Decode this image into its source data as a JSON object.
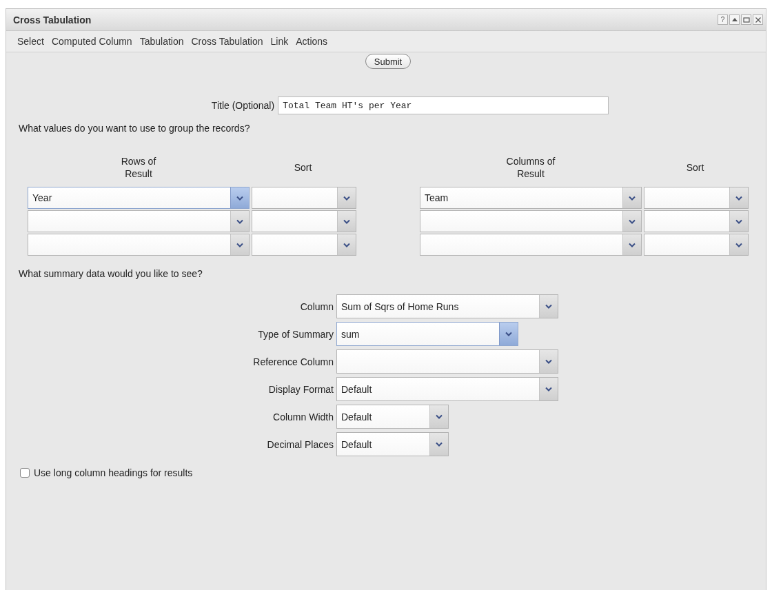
{
  "window": {
    "title": "Cross Tabulation",
    "title_buttons": [
      {
        "kind": "help",
        "glyph": "?"
      },
      {
        "kind": "collapse"
      },
      {
        "kind": "maximize"
      },
      {
        "kind": "close"
      }
    ]
  },
  "menu": [
    "Select",
    "Computed Column",
    "Tabulation",
    "Cross Tabulation",
    "Link",
    "Actions"
  ],
  "submit_button": "Submit",
  "title_field": {
    "label": "Title (Optional)",
    "value": "Total Team HT's per Year"
  },
  "group_question": "What values do you want to use to group the records?",
  "groups": [
    {
      "header": "Rows of Result",
      "sort_header": "Sort",
      "rows": [
        {
          "field": {
            "value": "Year",
            "focused": true
          },
          "sort": {
            "focused": false
          }
        },
        {
          "field": {
            "focused": false
          },
          "sort": {
            "focused": false
          }
        },
        {
          "field": {
            "focused": false
          },
          "sort": {
            "focused": false
          }
        }
      ]
    },
    {
      "header": "Columns of Result",
      "sort_header": "Sort",
      "rows": [
        {
          "field": {
            "value": "Team",
            "focused": false
          },
          "sort": {
            "focused": false
          }
        },
        {
          "field": {
            "focused": false
          },
          "sort": {
            "focused": false
          }
        },
        {
          "field": {
            "focused": false
          },
          "sort": {
            "focused": false
          }
        }
      ]
    }
  ],
  "summary_question": "What summary data would you like to see?",
  "summary_fields": [
    {
      "label": "Column",
      "value": "Sum of Sqrs of Home Runs",
      "focused": false
    },
    {
      "label": "Type of Summary",
      "value": "sum",
      "focused": true
    },
    {
      "label": "Reference Column",
      "focused": false
    },
    {
      "label": "Display Format",
      "value": "Default",
      "focused": false
    },
    {
      "label": "Column Width",
      "value": "Default",
      "focused": false
    },
    {
      "label": "Decimal Places",
      "value": "Default",
      "focused": false
    }
  ],
  "long_headings": {
    "label": "Use long column headings for results",
    "checked": false
  }
}
